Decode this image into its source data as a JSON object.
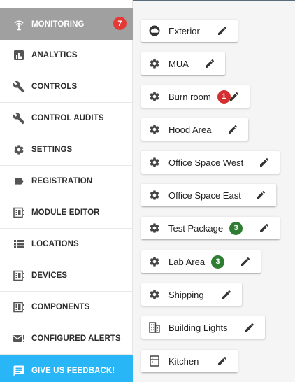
{
  "sidebar": {
    "items": [
      {
        "label": "MONITORING",
        "icon": "monitoring-antenna-icon",
        "badge": "7"
      },
      {
        "label": "ANALYTICS",
        "icon": "analytics-icon"
      },
      {
        "label": "CONTROLS",
        "icon": "wrench-icon"
      },
      {
        "label": "CONTROL AUDITS",
        "icon": "wrench-icon"
      },
      {
        "label": "SETTINGS",
        "icon": "gear-icon"
      },
      {
        "label": "REGISTRATION",
        "icon": "label-icon"
      },
      {
        "label": "MODULE EDITOR",
        "icon": "module-icon"
      },
      {
        "label": "LOCATIONS",
        "icon": "list-icon"
      },
      {
        "label": "DEVICES",
        "icon": "module-icon"
      },
      {
        "label": "COMPONENTS",
        "icon": "module-icon"
      },
      {
        "label": "CONFIGURED ALERTS",
        "icon": "mail-alert-icon"
      },
      {
        "label": "GIVE US FEEDBACK!",
        "icon": "feedback-icon"
      }
    ]
  },
  "locations": [
    {
      "label": "Exterior",
      "icon": "cloud-icon"
    },
    {
      "label": "MUA",
      "icon": "gear-icon"
    },
    {
      "label": "Burn room",
      "icon": "gear-icon",
      "badge": "1",
      "badge_color": "#d32f2f"
    },
    {
      "label": "Hood Area",
      "icon": "gear-icon"
    },
    {
      "label": "Office Space West",
      "icon": "gear-icon"
    },
    {
      "label": "Office Space East",
      "icon": "gear-icon"
    },
    {
      "label": "Test Package",
      "icon": "gear-icon",
      "badge": "3",
      "badge_color": "#2e7d32"
    },
    {
      "label": "Lab Area",
      "icon": "gear-icon",
      "badge": "3",
      "badge_color": "#2e7d32"
    },
    {
      "label": "Shipping",
      "icon": "gear-icon"
    },
    {
      "label": "Building Lights",
      "icon": "building-icon"
    },
    {
      "label": "Kitchen",
      "icon": "kitchen-icon"
    }
  ],
  "colors": {
    "active_nav": "#a0a0a0",
    "feedback": "#29b6f6",
    "alert_badge": "#e53935",
    "ok_badge": "#2e7d32"
  }
}
